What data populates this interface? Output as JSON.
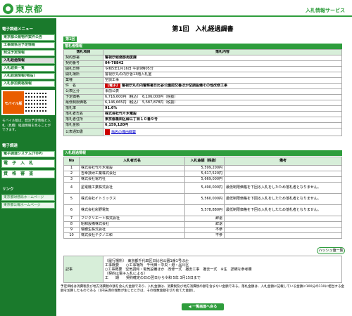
{
  "header": {
    "logo_text": "東京都",
    "service": "入札情報サービス"
  },
  "sidebar": {
    "menu_head": "電子調達メニュー",
    "items": [
      "東京都公報物件案件公告",
      "工事関係注予定情報",
      "発注予定情報",
      "入札経過情報",
      "入札結果一覧",
      "入札経過情報(物品)",
      "入札参加資格情報"
    ],
    "mobile_badge": "モバイル版",
    "mobile_note": "モバイル版は、発注予定情報と入札（見積）経過情報を見ることができます。",
    "system_head": "電子調達",
    "system_items": [
      "電子調達システム(TOP)",
      "電 子 入 札",
      "資 格 審 査"
    ],
    "links_head": "リンク",
    "links": [
      "東京都財務局ホームページ",
      "東京都公報ホームページ"
    ]
  },
  "main": {
    "title": "第1回　入札経過調書",
    "tab": "第1回",
    "info_bar": "落札者情報",
    "info_head": [
      "落札項目",
      "落札内容"
    ],
    "info": [
      {
        "label": "契約部署",
        "value": "警視庁総務部用度課",
        "bold": true
      },
      {
        "label": "契約番号",
        "value": "04-78842",
        "bold": true
      },
      {
        "label": "開札日時",
        "value": "令和5年1月16日 午前9時05分",
        "bold": false
      },
      {
        "label": "開札場所",
        "value": "警視庁丸の内庁舎13階入札室",
        "bold": false
      },
      {
        "label": "業種",
        "value": "空調工事",
        "bold": false
      }
    ],
    "subject_label": "件　名",
    "subject_tag": "【電子】",
    "subject": "警視庁丸の内警察署日比谷公園前交番ほか空調設備その他改修工事",
    "info2": [
      {
        "label": "公表区分",
        "value": "事前公表"
      },
      {
        "label": "予定価格",
        "value": "6,716,600円（税込）　6,106,000円（税抜）"
      },
      {
        "label": "最低制限価格",
        "value": "6,146,665円（税込）　5,587,878円（税抜）"
      },
      {
        "label": "落札率",
        "value": "91.6%",
        "bold": true
      },
      {
        "label": "落札者氏名",
        "value": "株式会社代々木電設",
        "bold": true
      },
      {
        "label": "落札者住所",
        "value": "東京都墨田区緑三丁目１０番９号",
        "bold": true
      },
      {
        "label": "落札金額",
        "value": "6,159,120円",
        "bold": true
      }
    ],
    "notice_label": "公表通知書",
    "notice_link": "指名の理由概要",
    "bidder_bar": "入札経過情報",
    "bidder_head": [
      "No",
      "入札者氏名",
      "入札金額（税抜）",
      "備考"
    ],
    "bidders": [
      {
        "no": "1",
        "name": "株式会社代々木電設",
        "amount": "5,599,200円",
        "note": ""
      },
      {
        "no": "2",
        "name": "吉幸技研工業株式会社",
        "amount": "5,617,520円",
        "note": ""
      },
      {
        "no": "3",
        "name": "株式会社電巧社",
        "amount": "5,669,000円",
        "note": ""
      },
      {
        "no": "4",
        "name": "星電機工業株式会社",
        "amount": "5,490,000円",
        "note": "最低制限価格を下回る入札をしたため落札者となりません。"
      },
      {
        "no": "5",
        "name": "株式会社イトミックス",
        "amount": "5,560,000円",
        "note": "最低制限価格を下回る入札をしたため落札者となりません。"
      },
      {
        "no": "6",
        "name": "株式会社彩野電気",
        "amount": "5,578,880円",
        "note": "最低制限価格を下回る入札をしたため落札者となりません。"
      },
      {
        "no": "7",
        "name": "フジクリエート株式会社",
        "amount": "辞退",
        "note": ""
      },
      {
        "no": "8",
        "name": "昭和設備株式会社",
        "amount": "辞退",
        "note": ""
      },
      {
        "no": "9",
        "name": "瑞穂生株式会社",
        "amount": "不参",
        "note": ""
      },
      {
        "no": "10",
        "name": "株式会社テクノ三和",
        "amount": "不参",
        "note": ""
      }
    ],
    "history_button": "ハッシュ値一覧",
    "remarks_label": "記事",
    "remarks": "〔履行場所〕　東京都千代田区日比谷公園1番1号ほか\n工事概要　　○工事場所　千代田・中央・港・品川区\n○工事概要　空気調和・電気設備ほか　改修一式　撤去工事　撤去一式　※注　詳細な参考欄\n〔契約は電子入札による〕\n工　　期　　契約確定の日の翌日から令和 5年 3月15日まで",
    "footnote": "予定価格は消費税及び地方消費税の額を含んだ金額であり、入札金額は、消費税及び地方消費税の額を含まない金額である。落札金額は、入札金額に記載している金額に100分の110に相当する金額を加算したものである（1円未満の端数が生じたときは、その端数金額を切り捨てた金額）。",
    "back_button": "◀ 一覧画面へ戻る"
  }
}
